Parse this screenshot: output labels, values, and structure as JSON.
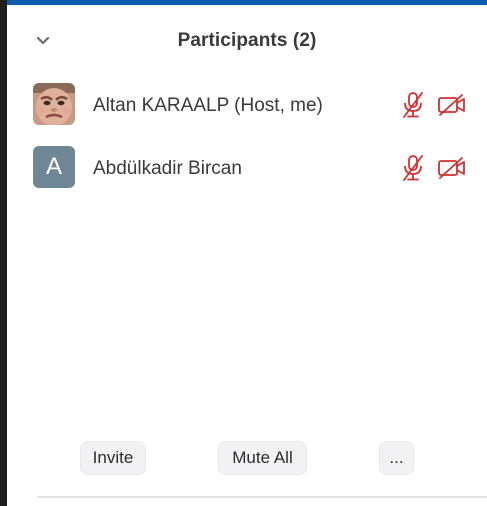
{
  "panel": {
    "title": "Participants (2)",
    "accent_color": "#0b5cad"
  },
  "participants": [
    {
      "name": "Altan KARAALP (Host, me)",
      "avatar_type": "photo",
      "audio_muted": true,
      "video_off": true
    },
    {
      "name": "Abdülkadir Bircan",
      "avatar_type": "initial",
      "avatar_initial": "A",
      "avatar_color": "#6f8694",
      "audio_muted": true,
      "video_off": true
    }
  ],
  "footer": {
    "invite_label": "Invite",
    "mute_all_label": "Mute All",
    "more_label": "..."
  },
  "icons": {
    "collapse": "chevron-down-icon",
    "mic": "microphone-muted-icon",
    "video": "video-off-icon"
  },
  "status_color_muted": "#d32f2f"
}
